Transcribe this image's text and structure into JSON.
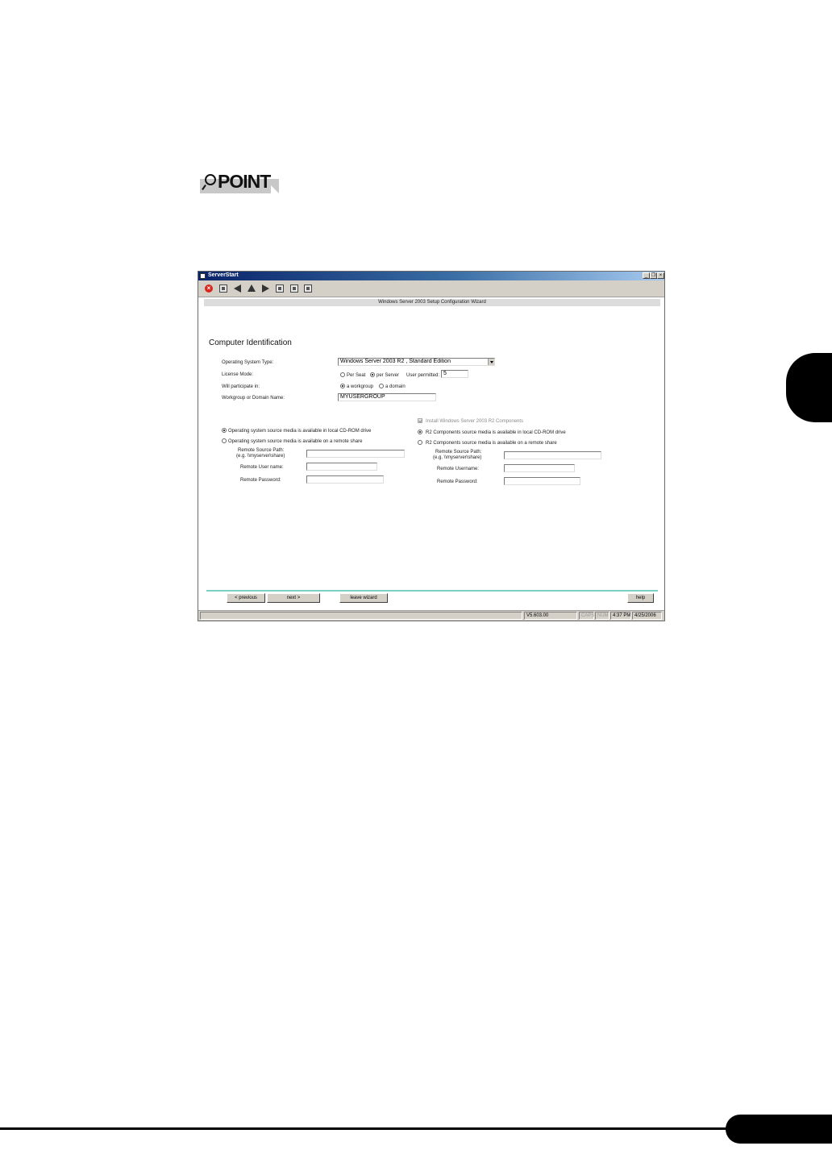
{
  "page": {
    "point_label": "POINT"
  },
  "window": {
    "title": "ServerStart",
    "controls": {
      "minimize": "_",
      "restore": "❐",
      "close": "×"
    },
    "toolbar_icons": [
      "stop-icon",
      "home-icon",
      "back-icon",
      "up-icon",
      "forward-icon",
      "grid-icon",
      "window-icon",
      "close-window-icon"
    ],
    "wizard_heading": "Windows Server 2003 Setup Configuration Wizard",
    "section_title": "Computer Identification",
    "form": {
      "os_type_label": "Operating System Type:",
      "os_type_value": "Windows Server 2003 R2 , Standard Edition",
      "license_label": "License Mode:",
      "per_seat": "Per Seat",
      "per_server": "per Server",
      "users_label": "User permitted:",
      "users_value": "5",
      "participate_label": "Will participate in:",
      "workgroup": "a workgroup",
      "domain": "a domain",
      "group_name_label": "Workgroup or Domain Name:",
      "group_name_value": "MYUSERGROUP"
    },
    "os_source": {
      "local": "Operating system source media is available in local CD-ROM drive",
      "remote": "Operating system source media is available on a remote share",
      "path_label_1": "Remote Source Path:",
      "path_label_2": "(e.g. \\\\myserver\\share)",
      "user_label": "Remote User name:",
      "password_label": "Remote Password:"
    },
    "r2": {
      "install_label": "Install Windows Server 2003 R2 Components",
      "local": "R2 Components source media is available in local CD-ROM drive",
      "remote": "R2 Components source media is available on a remote share",
      "path_label_1": "Remote Source Path:",
      "path_label_2": "(e.g. \\\\myserver\\share)",
      "user_label": "Remote Username:",
      "password_label": "Remote Password:"
    },
    "buttons": {
      "previous": "< previous",
      "next": "next >",
      "leave": "leave wizard",
      "help": "help"
    },
    "status": {
      "version": "V5.603.00",
      "caps": "CAPS",
      "num": "NUM",
      "time": "4:37 PM",
      "date": "4/25/2006"
    }
  }
}
